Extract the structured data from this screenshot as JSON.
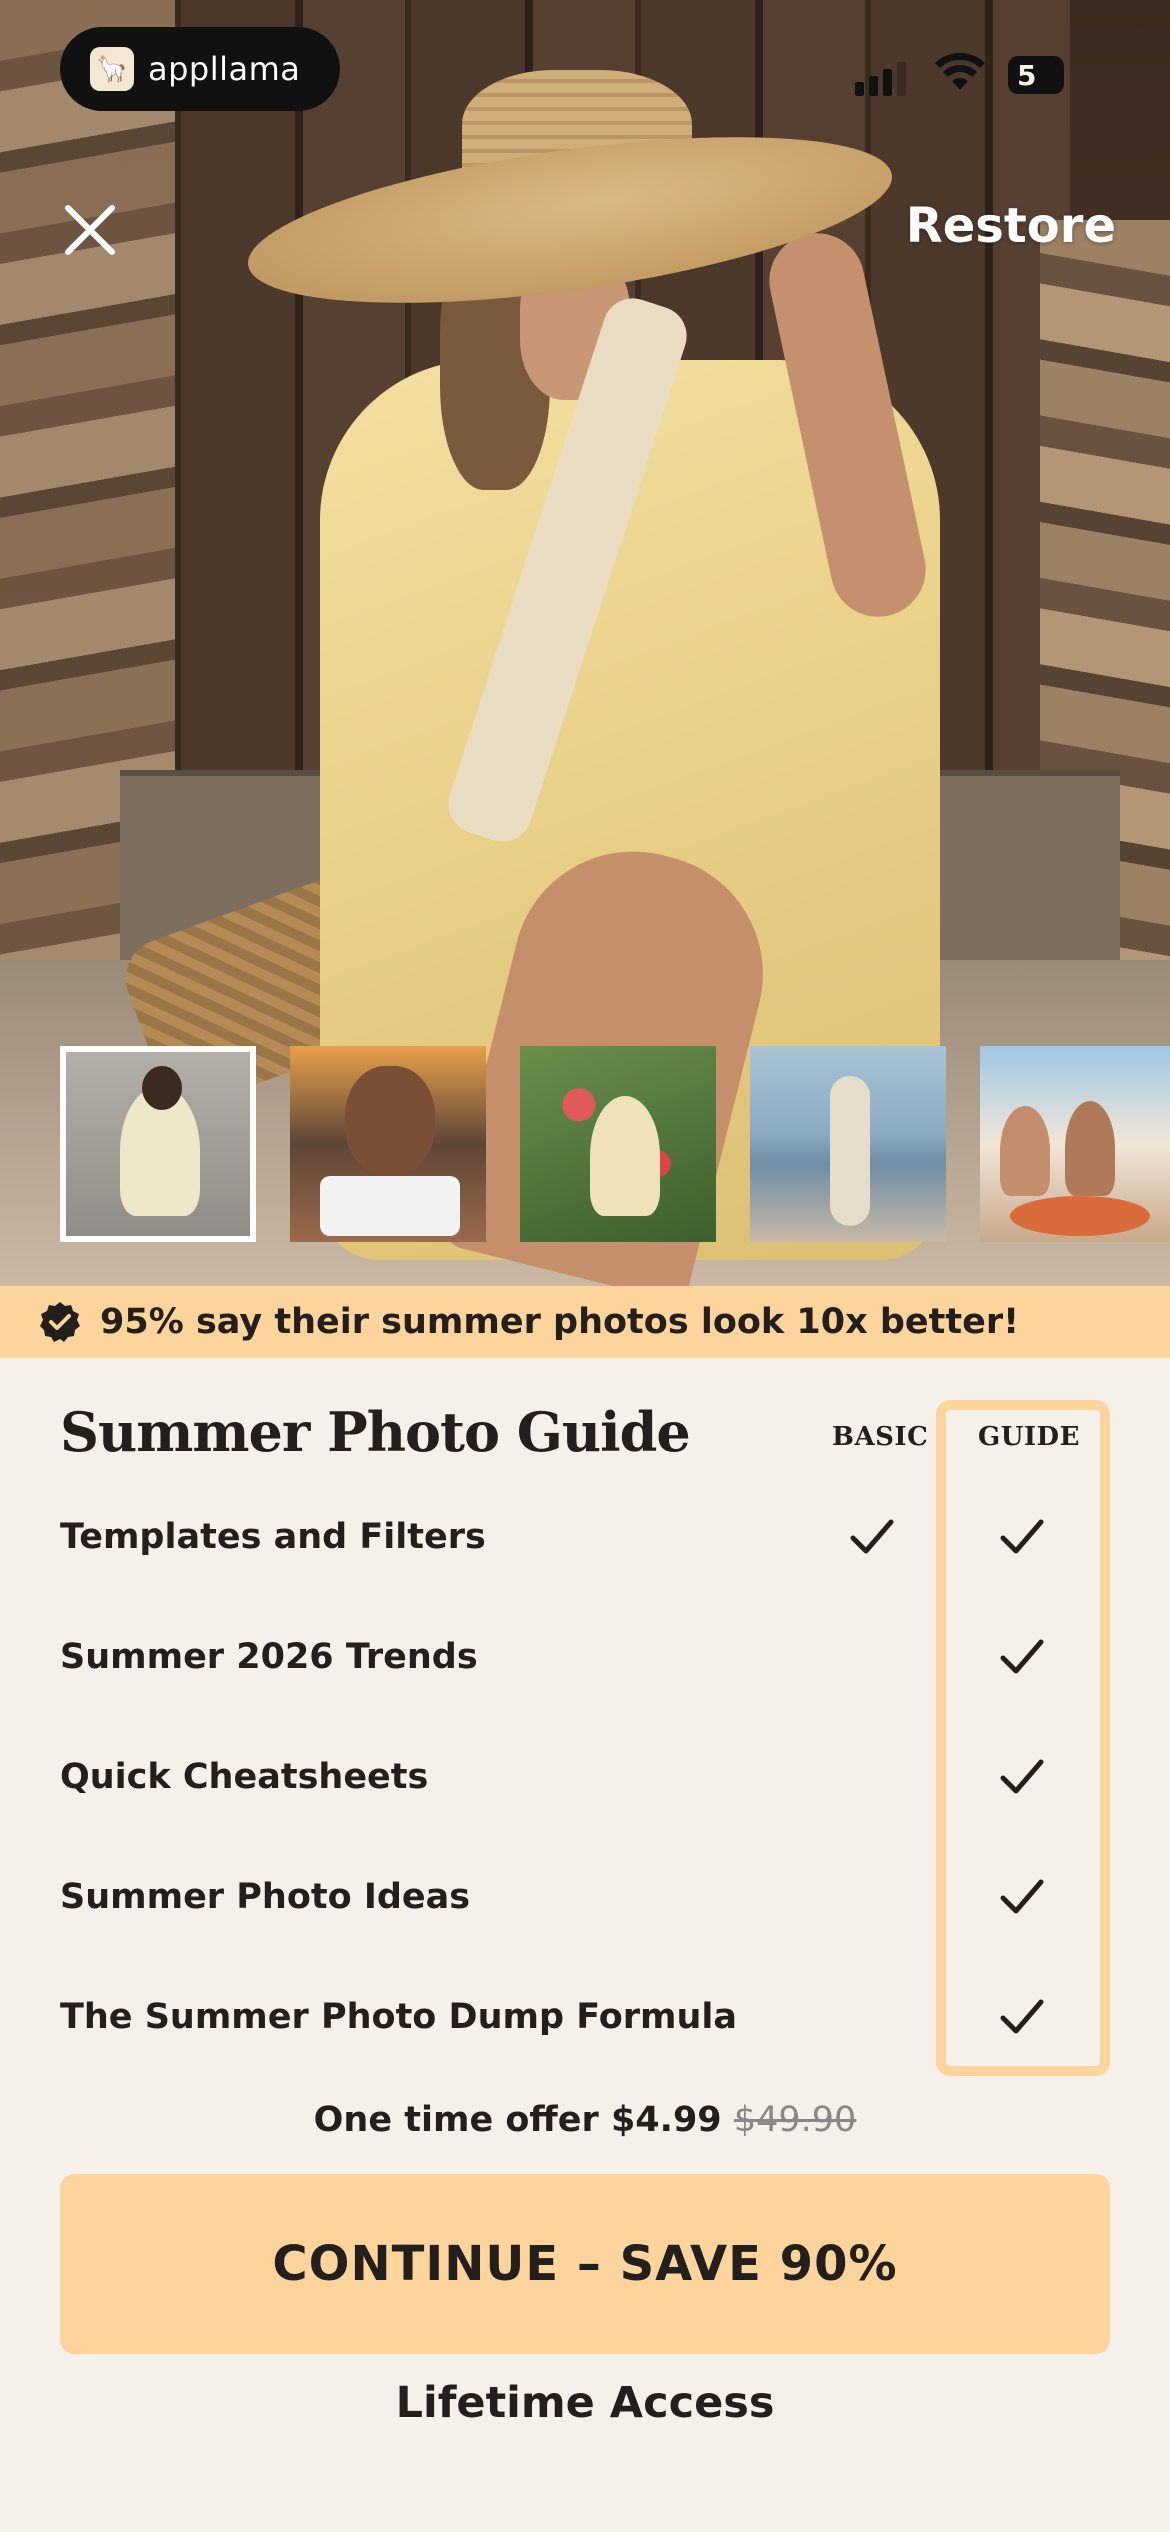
{
  "status_bar": {
    "brand_name": "appllama",
    "battery_level": "5"
  },
  "header": {
    "restore_label": "Restore"
  },
  "gallery": {
    "thumbnails": [
      {
        "label": "thumbnail-1",
        "selected": true
      },
      {
        "label": "thumbnail-2",
        "selected": false
      },
      {
        "label": "thumbnail-3",
        "selected": false
      },
      {
        "label": "thumbnail-4",
        "selected": false
      },
      {
        "label": "thumbnail-5",
        "selected": false
      }
    ]
  },
  "banner": {
    "text": "95% say their summer photos look 10x better!",
    "icon": "verified-badge-icon"
  },
  "comparison": {
    "title": "Summer Photo Guide",
    "col_basic": "BASIC",
    "col_guide": "GUIDE",
    "rows": [
      {
        "label": "Templates and Filters",
        "basic": true,
        "guide": true
      },
      {
        "label": "Summer 2026 Trends",
        "basic": false,
        "guide": true
      },
      {
        "label": "Quick Cheatsheets",
        "basic": false,
        "guide": true
      },
      {
        "label": "Summer Photo Ideas",
        "basic": false,
        "guide": true
      },
      {
        "label": "The Summer Photo Dump Formula",
        "basic": false,
        "guide": true
      }
    ]
  },
  "offer": {
    "text": "One time offer $4.99",
    "original_price": "$49.90"
  },
  "cta": {
    "label": "CONTINUE – SAVE 90%"
  },
  "footer": {
    "lifetime_label": "Lifetime Access"
  },
  "colors": {
    "accent": "#fdd49b",
    "background": "#f5f0ea",
    "text": "#231f1c"
  }
}
